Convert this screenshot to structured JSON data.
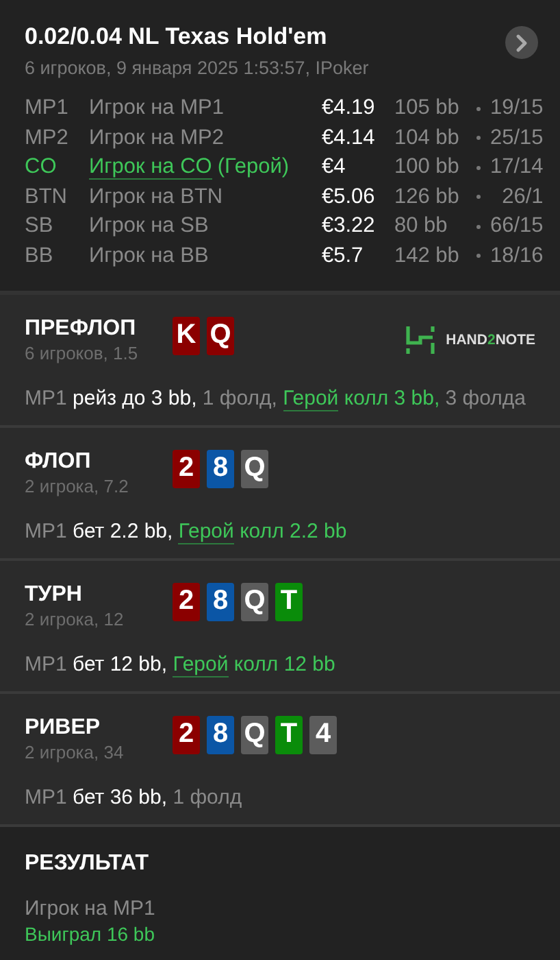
{
  "header": {
    "title": "0.02/0.04 NL Texas Hold'em",
    "subtitle": "6 игроков, 9 января 2025 1:53:57, IPoker"
  },
  "players": [
    {
      "position": "MP1",
      "name": "Игрок на MP1",
      "stack": "€4.19",
      "bb": "105 bb",
      "stats": "19/15",
      "hero": false
    },
    {
      "position": "MP2",
      "name": "Игрок на MP2",
      "stack": "€4.14",
      "bb": "104 bb",
      "stats": "25/15",
      "hero": false
    },
    {
      "position": "CO",
      "name": "Игрок на CO",
      "hero_tag": "(Герой)",
      "stack": "€4",
      "bb": "100 bb",
      "stats": "17/14",
      "hero": true
    },
    {
      "position": "BTN",
      "name": "Игрок на BTN",
      "stack": "€5.06",
      "bb": "126 bb",
      "stats": "26/1",
      "hero": false
    },
    {
      "position": "SB",
      "name": "Игрок на SB",
      "stack": "€3.22",
      "bb": "80 bb",
      "stats": "66/15",
      "hero": false
    },
    {
      "position": "BB",
      "name": "Игрок на BB",
      "stack": "€5.7",
      "bb": "142 bb",
      "stats": "18/16",
      "hero": false
    }
  ],
  "logo": [
    "HAND",
    "2",
    "NOTE"
  ],
  "streets": [
    {
      "title": "ПРЕФЛОП",
      "subtitle": "6 игроков, 1.5",
      "cards": [
        {
          "rank": "K",
          "color": "#8b0000"
        },
        {
          "rank": "Q",
          "color": "#8b0000"
        }
      ],
      "logo": true,
      "actions": [
        {
          "text": "MP1",
          "kind": "player"
        },
        {
          "text": "рейз до 3 bb,",
          "kind": "action"
        },
        {
          "text": "1 фолд,",
          "kind": "muted"
        },
        {
          "text": "Герой",
          "kind": "hero"
        },
        {
          "text": "колл 3 bb,",
          "kind": "hero_action"
        },
        {
          "text": "3 фолда",
          "kind": "muted"
        }
      ]
    },
    {
      "title": "ФЛОП",
      "subtitle": "2 игрока, 7.2",
      "cards": [
        {
          "rank": "2",
          "color": "#8b0000"
        },
        {
          "rank": "8",
          "color": "#0b56a6"
        },
        {
          "rank": "Q",
          "color": "#5c5c5c"
        }
      ],
      "actions": [
        {
          "text": "MP1",
          "kind": "player"
        },
        {
          "text": "бет 2.2 bb,",
          "kind": "action"
        },
        {
          "text": "Герой",
          "kind": "hero"
        },
        {
          "text": "колл 2.2 bb",
          "kind": "hero_action"
        }
      ]
    },
    {
      "title": "ТУРН",
      "subtitle": "2 игрока, 12",
      "cards": [
        {
          "rank": "2",
          "color": "#8b0000"
        },
        {
          "rank": "8",
          "color": "#0b56a6"
        },
        {
          "rank": "Q",
          "color": "#5c5c5c"
        },
        {
          "rank": "T",
          "color": "#0a8c0a"
        }
      ],
      "actions": [
        {
          "text": "MP1",
          "kind": "player"
        },
        {
          "text": "бет 12 bb,",
          "kind": "action"
        },
        {
          "text": "Герой",
          "kind": "hero"
        },
        {
          "text": "колл 12 bb",
          "kind": "hero_action"
        }
      ]
    },
    {
      "title": "РИВЕР",
      "subtitle": "2 игрока, 34",
      "cards": [
        {
          "rank": "2",
          "color": "#8b0000"
        },
        {
          "rank": "8",
          "color": "#0b56a6"
        },
        {
          "rank": "Q",
          "color": "#5c5c5c"
        },
        {
          "rank": "T",
          "color": "#0a8c0a"
        },
        {
          "rank": "4",
          "color": "#5c5c5c"
        }
      ],
      "actions": [
        {
          "text": "MP1",
          "kind": "player"
        },
        {
          "text": "бет 36 bb,",
          "kind": "action"
        },
        {
          "text": "1 фолд",
          "kind": "muted"
        }
      ]
    }
  ],
  "result": {
    "title": "РЕЗУЛЬТАТ",
    "player": "Игрок на MP1",
    "outcome": "Выиграл 16 bb"
  }
}
